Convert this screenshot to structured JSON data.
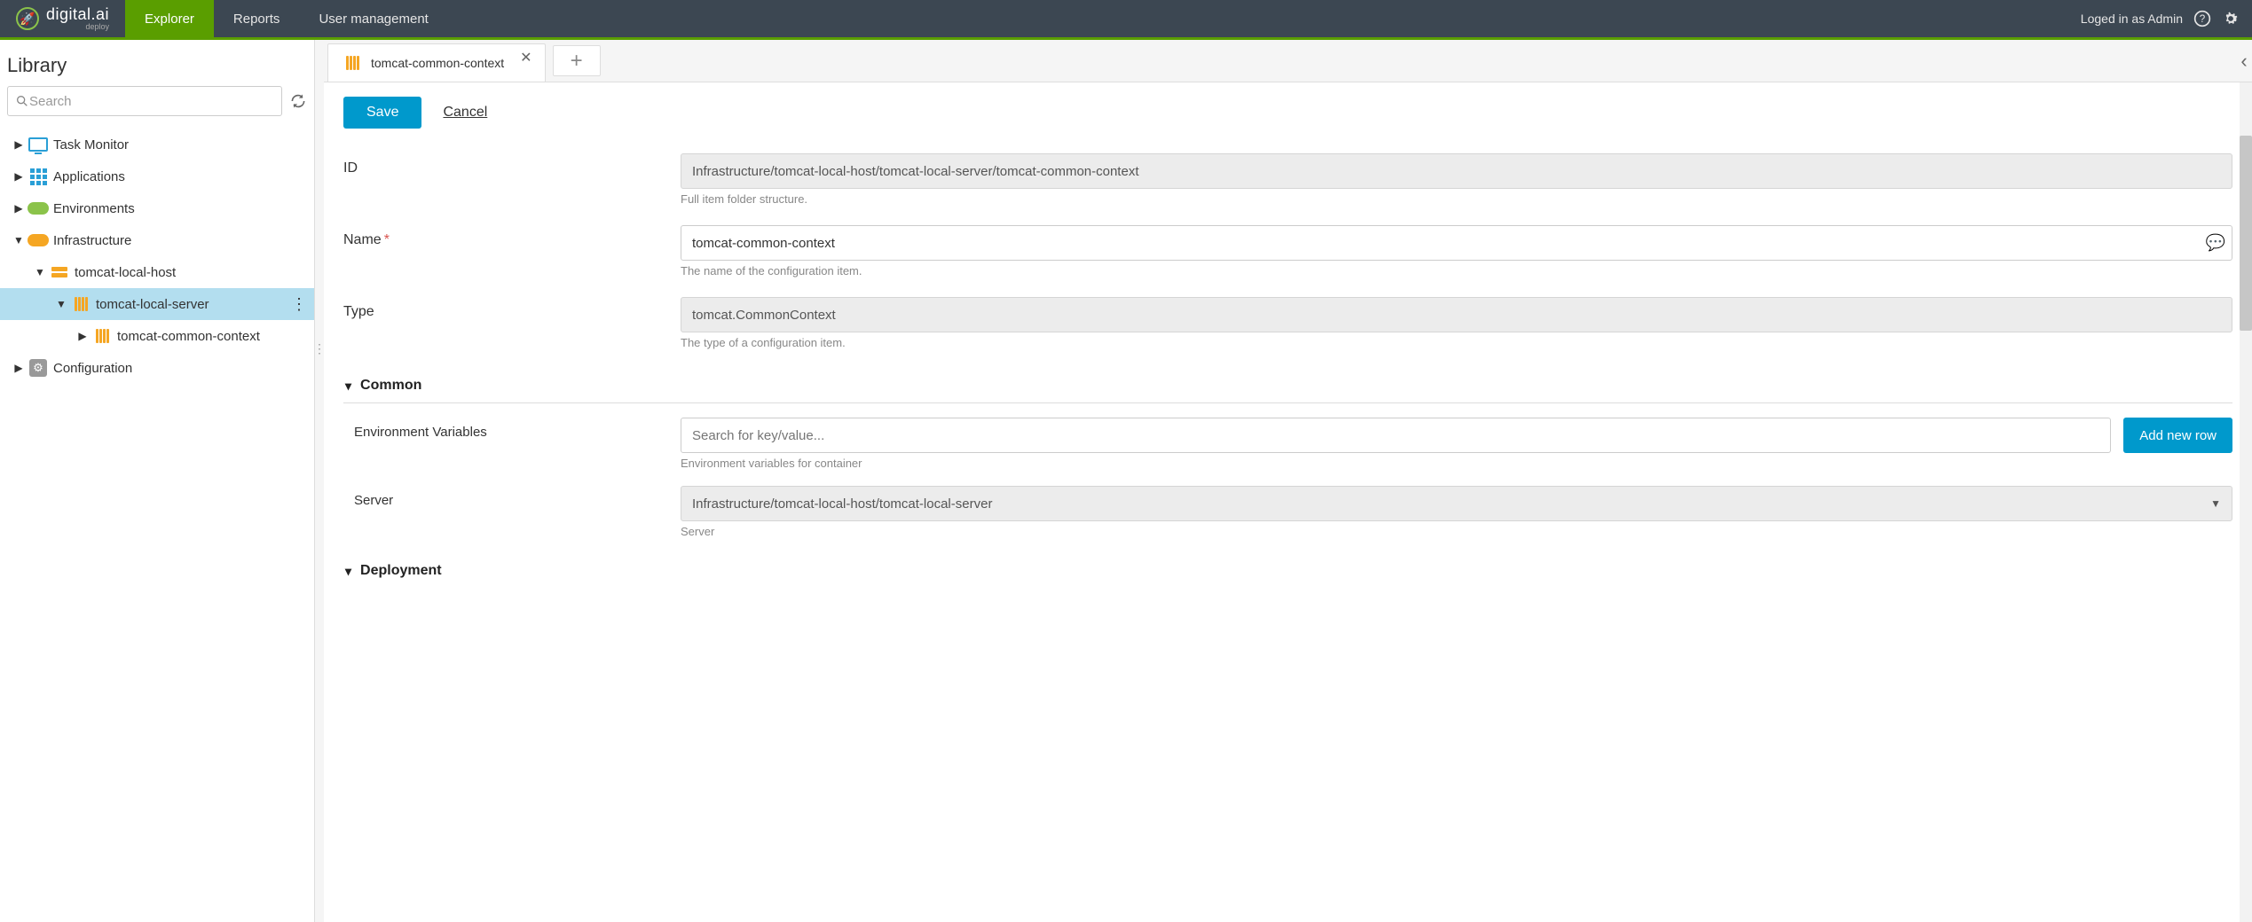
{
  "brand": {
    "name": "digital.ai",
    "sub": "deploy"
  },
  "nav": {
    "explorer": "Explorer",
    "reports": "Reports",
    "user_mgmt": "User management"
  },
  "topbar": {
    "logged_in": "Loged in as Admin"
  },
  "sidebar": {
    "title": "Library",
    "search_placeholder": "Search",
    "nodes": {
      "task_monitor": "Task Monitor",
      "applications": "Applications",
      "environments": "Environments",
      "infrastructure": "Infrastructure",
      "host": "tomcat-local-host",
      "server": "tomcat-local-server",
      "context": "tomcat-common-context",
      "configuration": "Configuration"
    }
  },
  "tabs": {
    "active": "tomcat-common-context"
  },
  "buttons": {
    "save": "Save",
    "cancel": "Cancel",
    "add_row": "Add new row"
  },
  "form": {
    "id_label": "ID",
    "id_value": "Infrastructure/tomcat-local-host/tomcat-local-server/tomcat-common-context",
    "id_hint": "Full item folder structure.",
    "name_label": "Name",
    "name_value": "tomcat-common-context",
    "name_hint": "The name of the configuration item.",
    "type_label": "Type",
    "type_value": "tomcat.CommonContext",
    "type_hint": "The type of a configuration item.",
    "section_common": "Common",
    "env_label": "Environment Variables",
    "env_placeholder": "Search for key/value...",
    "env_hint": "Environment variables for container",
    "server_label": "Server",
    "server_value": "Infrastructure/tomcat-local-host/tomcat-local-server",
    "server_hint": "Server",
    "section_deployment": "Deployment"
  }
}
